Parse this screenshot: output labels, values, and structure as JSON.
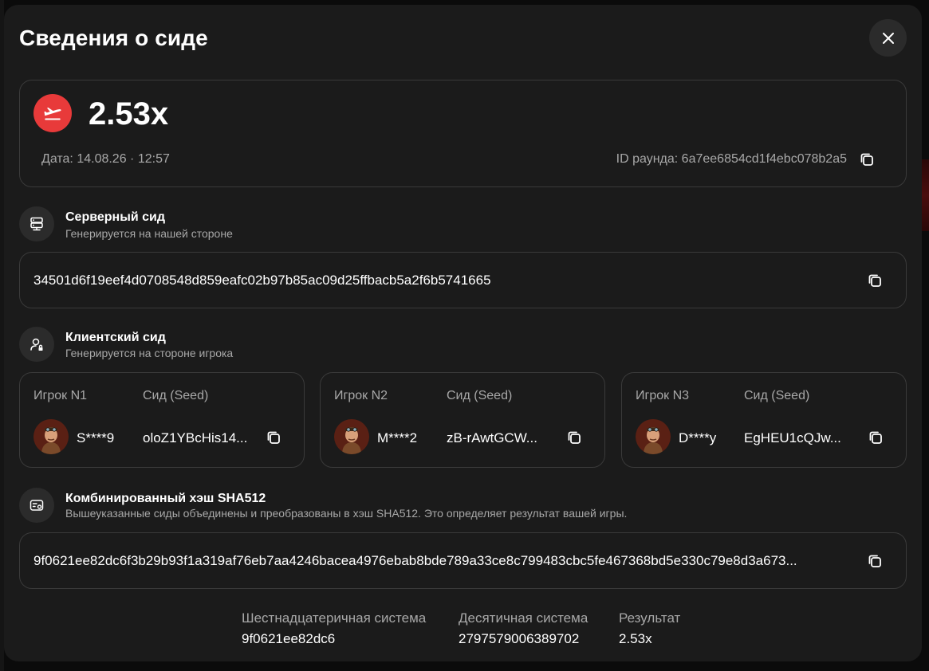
{
  "modal": {
    "title": "Сведения о сиде"
  },
  "result": {
    "multiplier": "2.53x",
    "date": "Дата: 14.08.26 · 12:57",
    "round_id": "ID раунда: 6a7ee6854cd1f4ebc078b2a5",
    "badge_color": "#e83a3a"
  },
  "server_seed": {
    "title": "Серверный сид",
    "subtitle": "Генерируется на нашей стороне",
    "value": "34501d6f19eef4d0708548d859eafc02b97b85ac09d25ffbacb5a2f6b5741665"
  },
  "client_seed": {
    "title": "Клиентский сид",
    "subtitle": "Генерируется на стороне игрока",
    "players": [
      {
        "player_label": "Игрок N1",
        "seed_label": "Сид (Seed)",
        "name": "S****9",
        "seed": "oloZ1YBcHis14..."
      },
      {
        "player_label": "Игрок N2",
        "seed_label": "Сид (Seed)",
        "name": "M****2",
        "seed": "zB-rAwtGCW..."
      },
      {
        "player_label": "Игрок N3",
        "seed_label": "Сид (Seed)",
        "name": "D****y",
        "seed": "EgHEU1cQJw..."
      }
    ]
  },
  "combined_hash": {
    "title": "Комбинированный хэш SHA512",
    "subtitle": "Вышеуказанные сиды объединены и преобразованы в хэш SHA512. Это определяет результат вашей игры.",
    "value": "9f0621ee82dc6f3b29b93f1a319af76eb7aa4246bacea4976ebab8bde789a33ce8c799483cbc5fe467368bd5e330c79e8d3a673..."
  },
  "stats": {
    "hex_label": "Шестнадцатеричная система",
    "hex_value": "9f0621ee82dc6",
    "dec_label": "Десятичная система",
    "dec_value": "2797579006389702",
    "result_label": "Результат",
    "result_value": "2.53x"
  },
  "icons": {
    "close": "close-icon",
    "plane": "plane-takeoff-icon",
    "copy": "copy-icon",
    "server": "server-icon",
    "user_lock": "user-lock-icon",
    "hash": "hash-card-icon"
  }
}
